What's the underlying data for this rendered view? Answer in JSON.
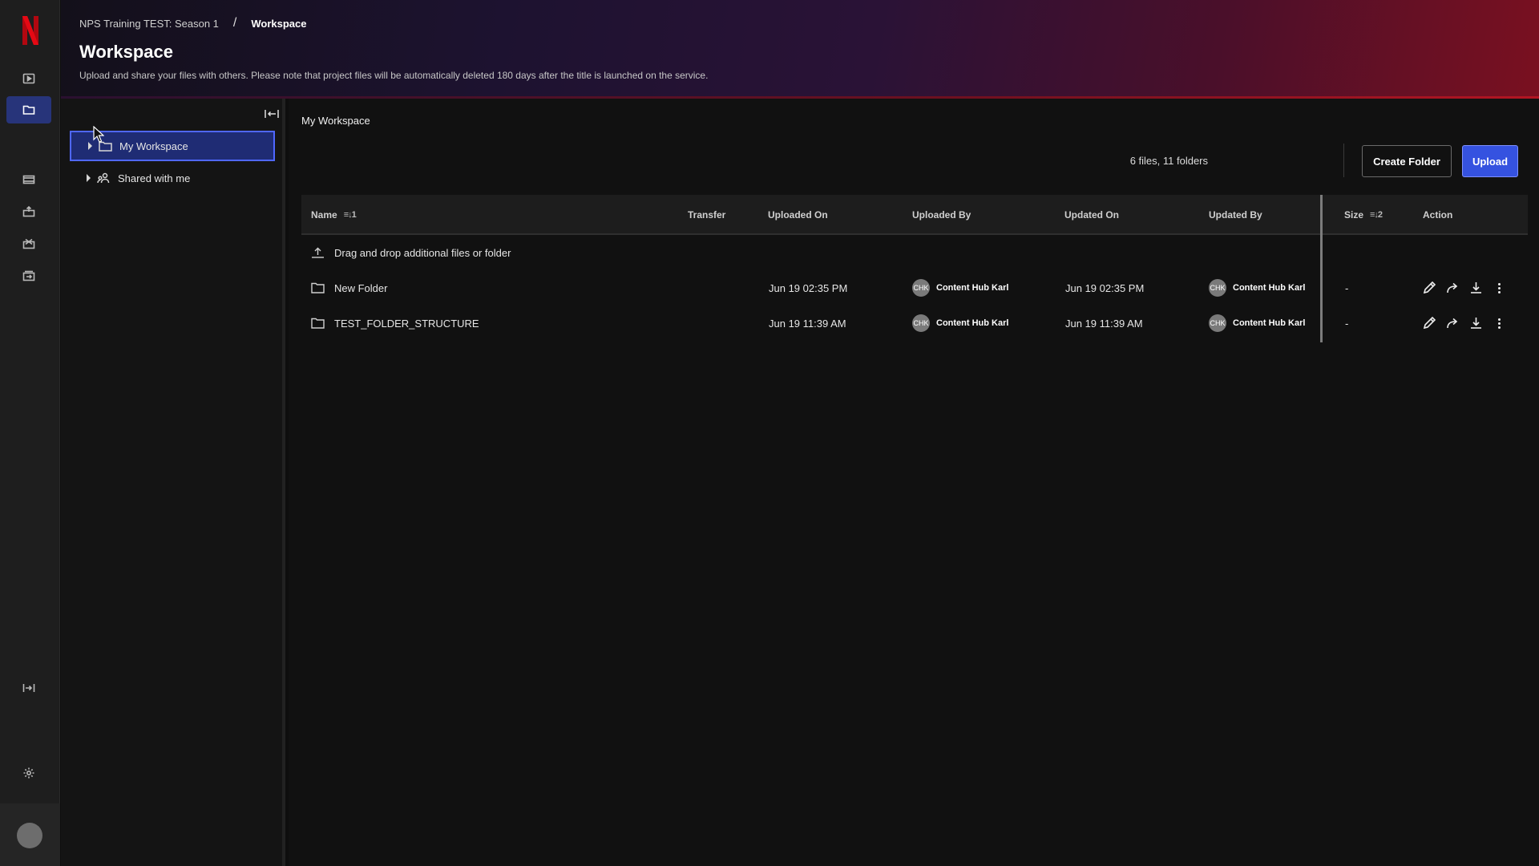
{
  "app": {
    "brand": "N"
  },
  "breadcrumb": {
    "parent": "NPS Training TEST: Season 1",
    "separator": "/",
    "current": "Workspace"
  },
  "header": {
    "title": "Workspace",
    "subtitle": "Upload and share your files with others. Please note that project files will be automatically deleted 180 days after the title is launched on the service."
  },
  "tree": {
    "items": [
      {
        "label": "My Workspace",
        "selected": true
      },
      {
        "label": "Shared with me",
        "selected": false
      }
    ]
  },
  "main": {
    "section_title": "My Workspace",
    "count": "6 files, 11 folders",
    "create_folder_label": "Create Folder",
    "upload_label": "Upload"
  },
  "table": {
    "columns": {
      "name": "Name",
      "name_sort": "≡↓1",
      "transfer": "Transfer",
      "uploaded_on": "Uploaded On",
      "uploaded_by": "Uploaded By",
      "updated_on": "Updated On",
      "updated_by": "Updated By",
      "size": "Size",
      "size_sort": "≡↓2",
      "action": "Action"
    },
    "dropzone": "Drag and drop additional files or folder",
    "rows": [
      {
        "name": "New Folder",
        "uploaded_on": "Jun 19 02:35 PM",
        "uploaded_by_initials": "CHK",
        "uploaded_by": "Content Hub Karl",
        "updated_on": "Jun 19 02:35 PM",
        "updated_by_initials": "CHK",
        "updated_by": "Content Hub Karl",
        "size": "-"
      },
      {
        "name": "TEST_FOLDER_STRUCTURE",
        "uploaded_on": "Jun 19 11:39 AM",
        "uploaded_by_initials": "CHK",
        "uploaded_by": "Content Hub Karl",
        "updated_on": "Jun 19 11:39 AM",
        "updated_by_initials": "CHK",
        "updated_by": "Content Hub Karl",
        "size": "-"
      }
    ]
  },
  "colors": {
    "accent": "#3552e0",
    "selected_bg": "#1f2c74",
    "brand_red": "#e50914"
  }
}
